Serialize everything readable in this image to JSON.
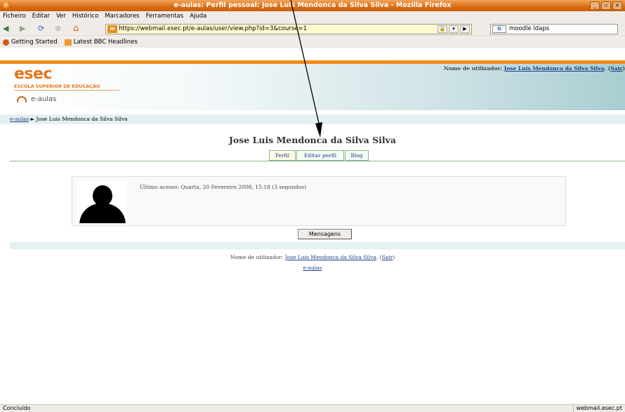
{
  "window": {
    "title": "e-aulas: Perfil pessoal: Jose Luis Mendonca da Silva Silva - Mozilla Firefox",
    "buttons": [
      "_",
      "▫",
      "×"
    ]
  },
  "menu": [
    "Ficheiro",
    "Editar",
    "Ver",
    "Histórico",
    "Marcadores",
    "Ferramentas",
    "Ajuda"
  ],
  "toolbar": {
    "back": "◀",
    "forward": "▶",
    "reload": "⟳",
    "stop": "⊗",
    "home": "⌂",
    "url": "https://webmail.esec.pt/e-aulas/user/view.php?id=3&course=1",
    "search_value": "moodle ldaps",
    "search_engine": "G"
  },
  "bookmarks": [
    {
      "label": "Getting Started",
      "icon": "firefox-icon"
    },
    {
      "label": "Latest BBC Headlines",
      "icon": "rss-icon"
    }
  ],
  "site": {
    "logo": "esec",
    "logo_subtitle": "ESCOLA SUPERIOR DE EDUCAÇÃO",
    "name": "e-aulas",
    "login_prefix": "Nome de utilizador: ",
    "user_name": "Jose Luis Mendonca da Silva Silva",
    "logout": "Sair"
  },
  "breadcrumb": {
    "home": "e-aulas",
    "separator": " ► ",
    "current": "Jose Luis Mendonca da Silva Silva"
  },
  "profile": {
    "title": "Jose Luis Mendonca da Silva Silva",
    "tabs": [
      "Perfil",
      "Editar perfil",
      "Blog"
    ],
    "last_access": "Último acesso:  Quarta, 20 Fevereiro 2008, 15:18  (3 segundos)",
    "messages_button": "Mensagens"
  },
  "footer": {
    "login_prefix": "Nome de utilizador: ",
    "user_name": "Jose Luis Mendonca da Silva Silva",
    "logout": "Sair",
    "home": "e-aulas"
  },
  "status": {
    "left": "Concluído",
    "right": "webmail.esec.pt"
  }
}
